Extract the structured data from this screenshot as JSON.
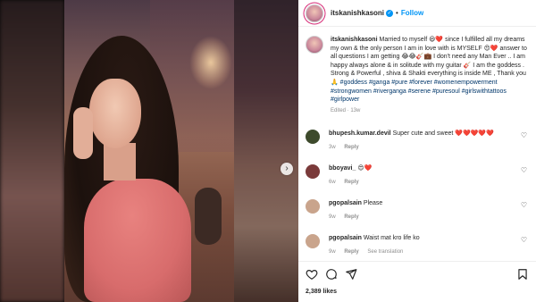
{
  "post": {
    "username": "itskanishkasoni",
    "follow_label": "Follow",
    "dot_separator": "•",
    "caption_text": "Married to myself 😃❤️ since I fulfilled all my dreams my own & the only person I am in love with is MYSELF 😍❤️ answer to all questions I am getting 😂😂🎸💼 I don't need any Man Ever .. I am happy always alone & in solitude with my guitar 🎸 I am the goddess . Strong & Powerful , shiva & Shakti everything is inside ME , Thank you 🙏",
    "hashtags": "#goddess #ganga #pure #forever #womenempowerment #strongwomen #riverganga #serene #puresoul #girlswithtattoos #girlpower",
    "edited_meta": "Edited · 13w",
    "likes": "2,389 likes"
  },
  "comments": [
    {
      "username": "bhupesh.kumar.devil",
      "text": "Super cute and sweet ❤️❤️❤️❤️❤️",
      "time": "3w",
      "reply_label": "Reply",
      "avatar_color": "#3d4a2c"
    },
    {
      "username": "bboyavi_",
      "text": "😍❤️",
      "time": "6w",
      "reply_label": "Reply",
      "avatar_color": "#7a3a3a"
    },
    {
      "username": "pgopalsain",
      "text": "Please",
      "time": "9w",
      "reply_label": "Reply",
      "avatar_color": "#c9a48c"
    },
    {
      "username": "pgopalsain",
      "text": "Waist mat kro life ko",
      "time": "9w",
      "reply_label": "Reply",
      "see_translation": "See translation",
      "avatar_color": "#c9a48c"
    }
  ],
  "icons": {
    "like": "heart-icon",
    "comment": "comment-icon",
    "share": "share-icon",
    "save": "bookmark-icon",
    "next": "chevron-right-icon"
  },
  "colors": {
    "accent": "#0095f6",
    "hashtag": "#00376b",
    "muted": "#8e8e8e"
  }
}
